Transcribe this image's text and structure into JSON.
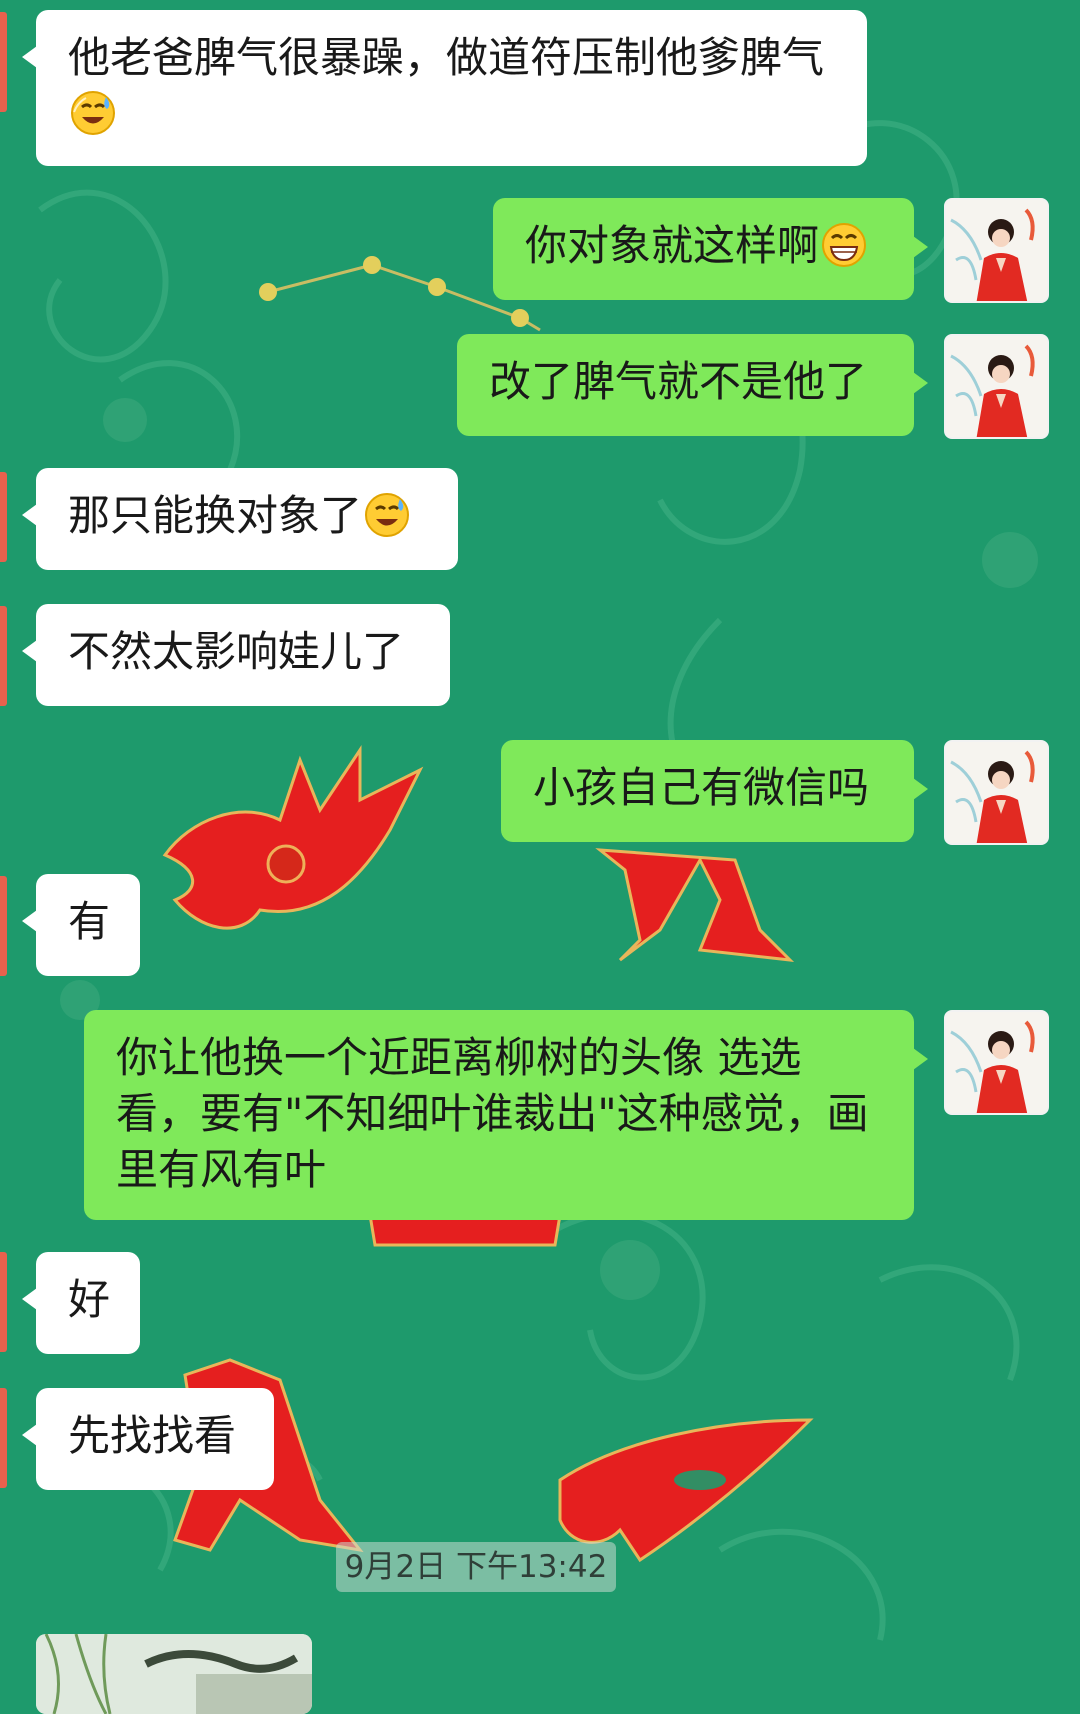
{
  "chat": {
    "messages": [
      {
        "side": "in",
        "text": "他老爸脾气很暴躁，做道符压制他爹脾气",
        "emoji": "sweat-smile-emoji"
      },
      {
        "side": "out",
        "text": "你对象就这样啊",
        "emoji": "grinning-emoji"
      },
      {
        "side": "out",
        "text": "改了脾气就不是他了"
      },
      {
        "side": "in",
        "text": "那只能换对象了",
        "emoji": "sweat-smile-emoji"
      },
      {
        "side": "in",
        "text": "不然太影响娃儿了"
      },
      {
        "side": "out",
        "text": "小孩自己有微信吗"
      },
      {
        "side": "in",
        "text": "有"
      },
      {
        "side": "out",
        "text": "你让他换一个近距离柳树的头像 选选看，要有\"不知细叶谁裁出\"这种感觉，画里有风有叶"
      },
      {
        "side": "in",
        "text": "好"
      },
      {
        "side": "in",
        "text": "先找找看"
      }
    ],
    "timestamp": "9月2日 下午13:42",
    "colors": {
      "background": "#1e9a6c",
      "incoming_bubble": "#ffffff",
      "outgoing_bubble": "#7fe95a",
      "sender_edge": "#e8614d",
      "text": "#191919"
    }
  }
}
